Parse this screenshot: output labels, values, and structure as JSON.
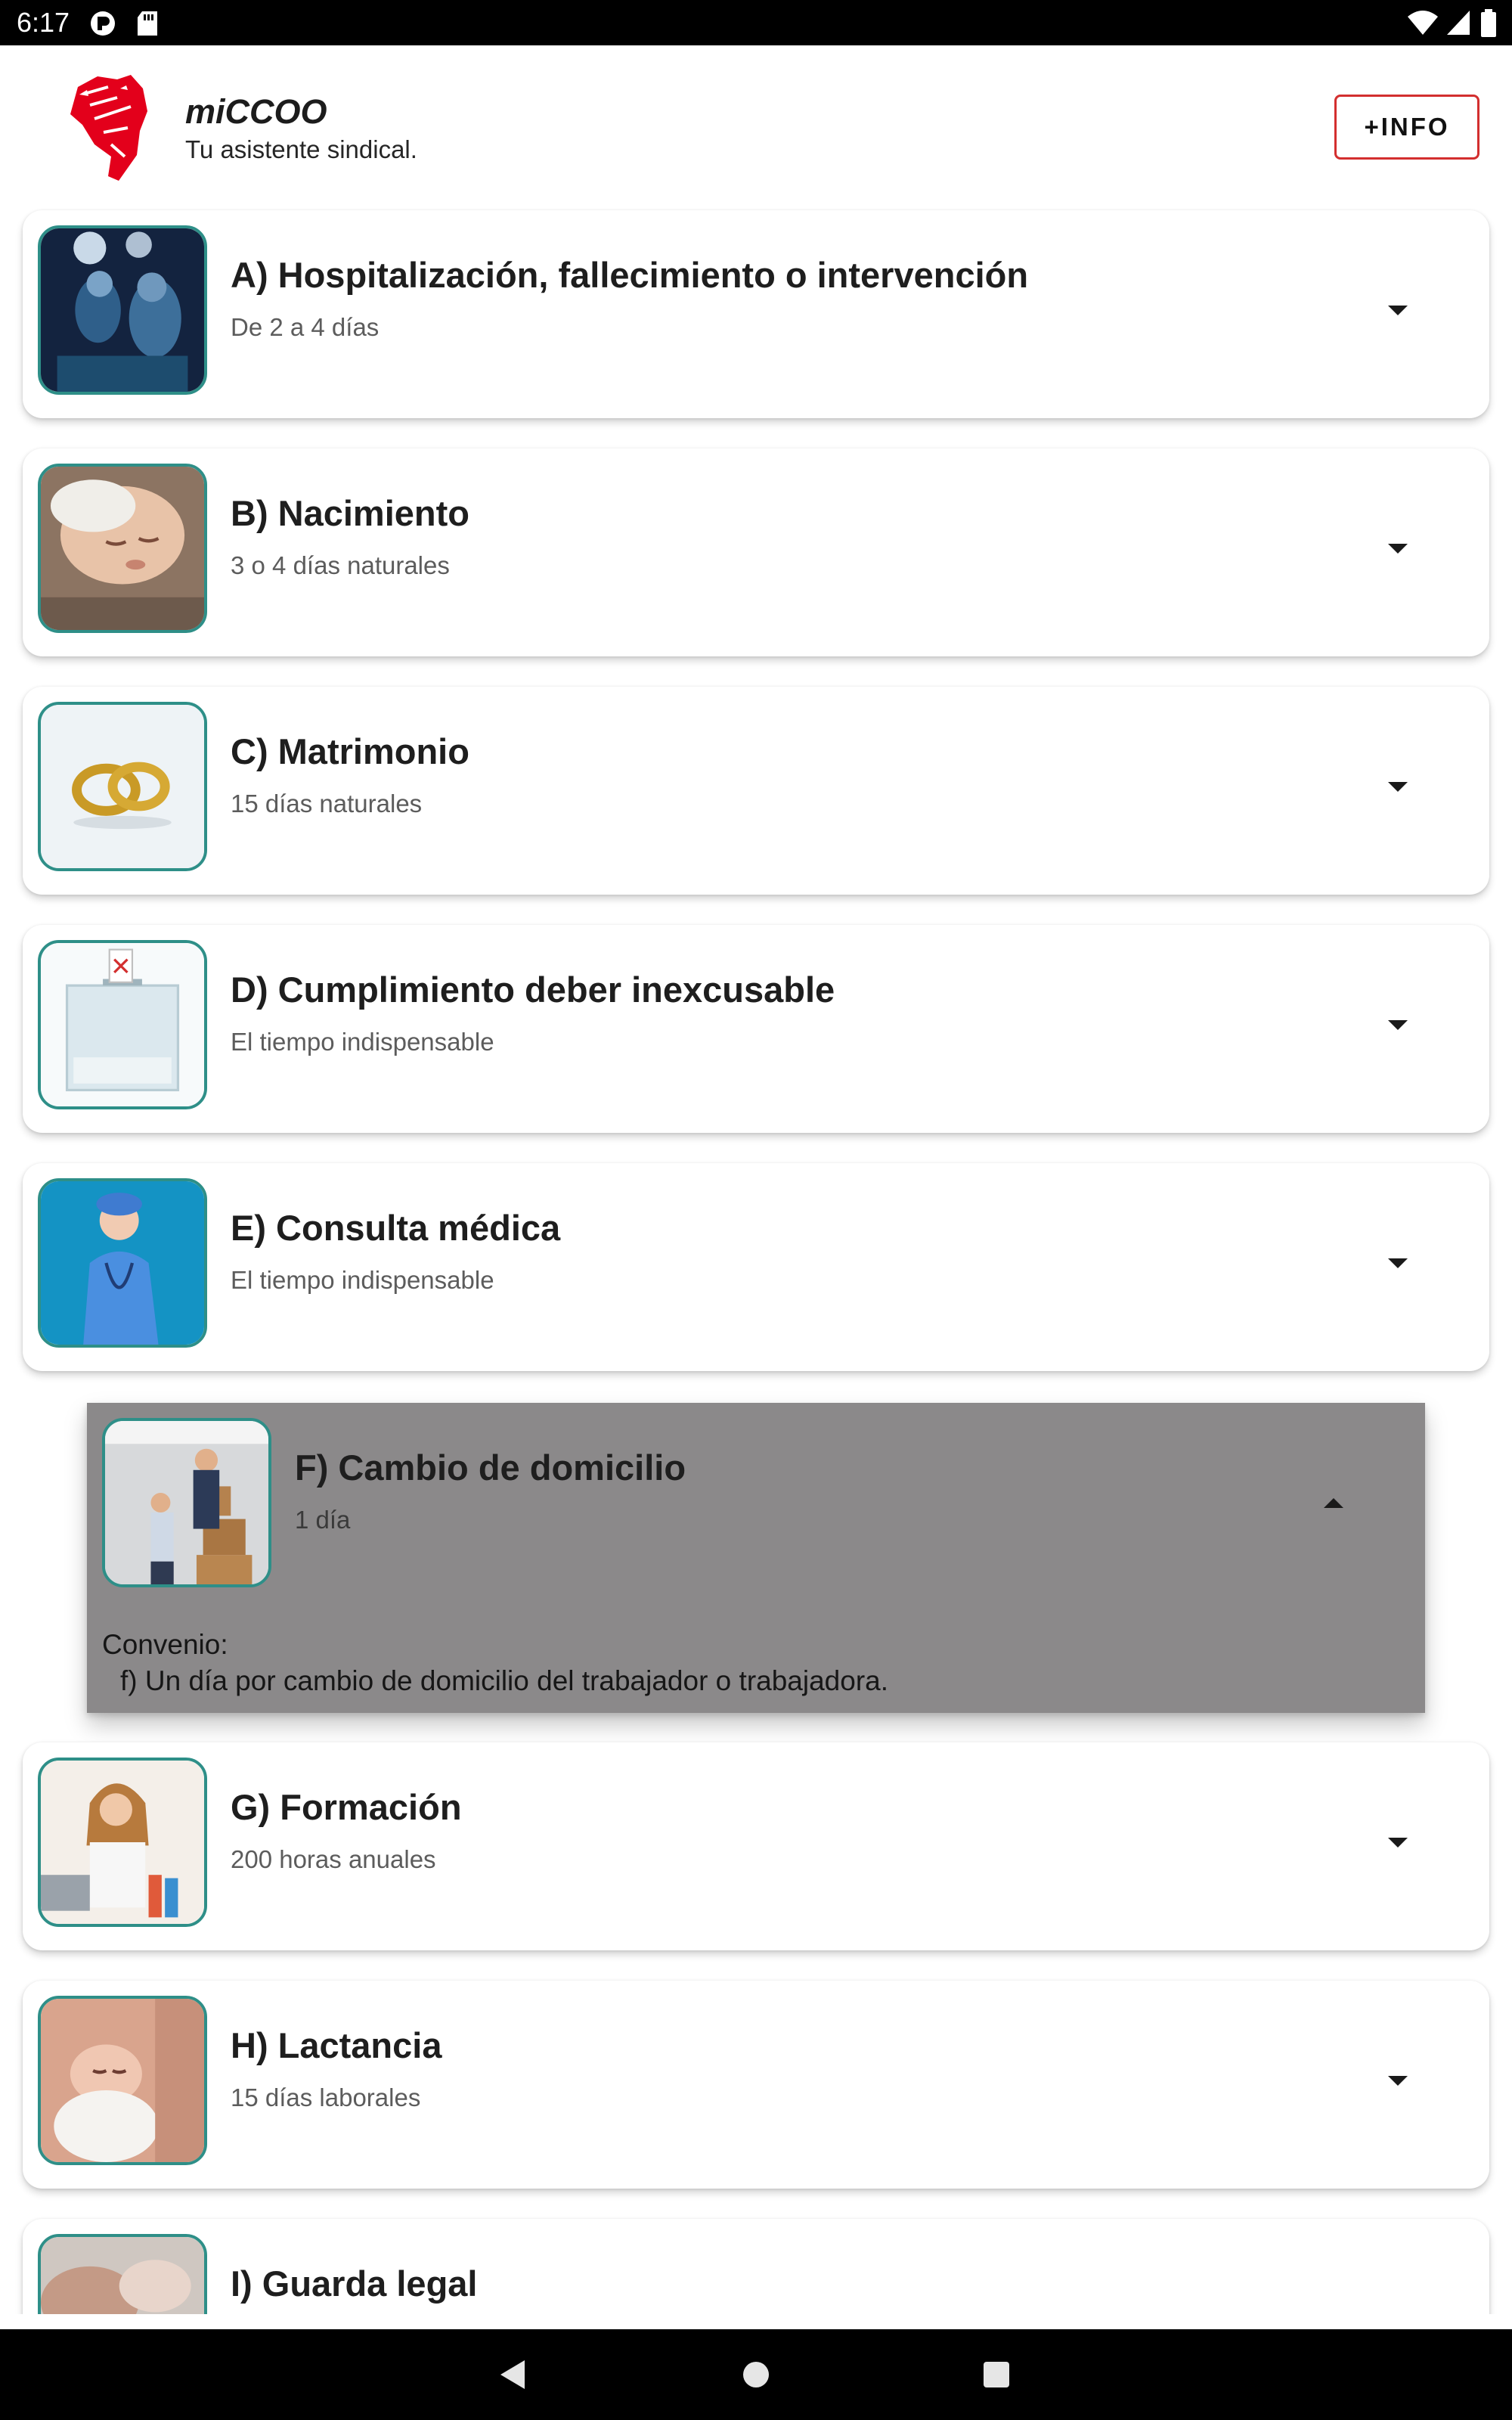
{
  "status_bar": {
    "time": "6:17"
  },
  "header": {
    "app_name": "miCCOO",
    "tagline": "Tu asistente sindical.",
    "info_button": "+INFO",
    "logo_icon": "raised-fist-icon",
    "brand_color": "#e3001b"
  },
  "leaves": [
    {
      "title": "A) Hospitalización, fallecimiento o intervención",
      "subtitle": "De 2 a 4 días",
      "thumbnail": "surgery-photo",
      "expanded": false
    },
    {
      "title": "B) Nacimiento",
      "subtitle": "3 o 4 días naturales",
      "thumbnail": "sleeping-baby-photo",
      "expanded": false
    },
    {
      "title": "C) Matrimonio",
      "subtitle": "15 días naturales",
      "thumbnail": "wedding-rings-photo",
      "expanded": false
    },
    {
      "title": "D) Cumplimiento deber inexcusable",
      "subtitle": "El tiempo indispensable",
      "thumbnail": "ballot-box-photo",
      "expanded": false
    },
    {
      "title": "E) Consulta médica",
      "subtitle": "El tiempo indispensable",
      "thumbnail": "doctor-photo",
      "expanded": false
    },
    {
      "title": "F) Cambio de domicilio",
      "subtitle": "1 día",
      "thumbnail": "moving-boxes-photo",
      "expanded": true,
      "detail_heading": "Convenio:",
      "detail_text": "f) Un día por cambio de domicilio del trabajador o trabajadora."
    },
    {
      "title": "G) Formación",
      "subtitle": "200 horas anuales",
      "thumbnail": "student-studying-photo",
      "expanded": false
    },
    {
      "title": "H) Lactancia",
      "subtitle": "15 días laborales",
      "thumbnail": "newborn-photo",
      "expanded": false
    },
    {
      "title": "I) Guarda legal",
      "subtitle": "",
      "thumbnail": "elderly-care-photo",
      "expanded": false
    }
  ],
  "colors": {
    "thumbnail_border": "#2e8f88",
    "expanded_card": "#8b898a",
    "info_border": "#d32f2f"
  },
  "nav_bar": {
    "back_icon": "back-triangle-icon",
    "home_icon": "home-circle-icon",
    "recents_icon": "recents-square-icon"
  }
}
